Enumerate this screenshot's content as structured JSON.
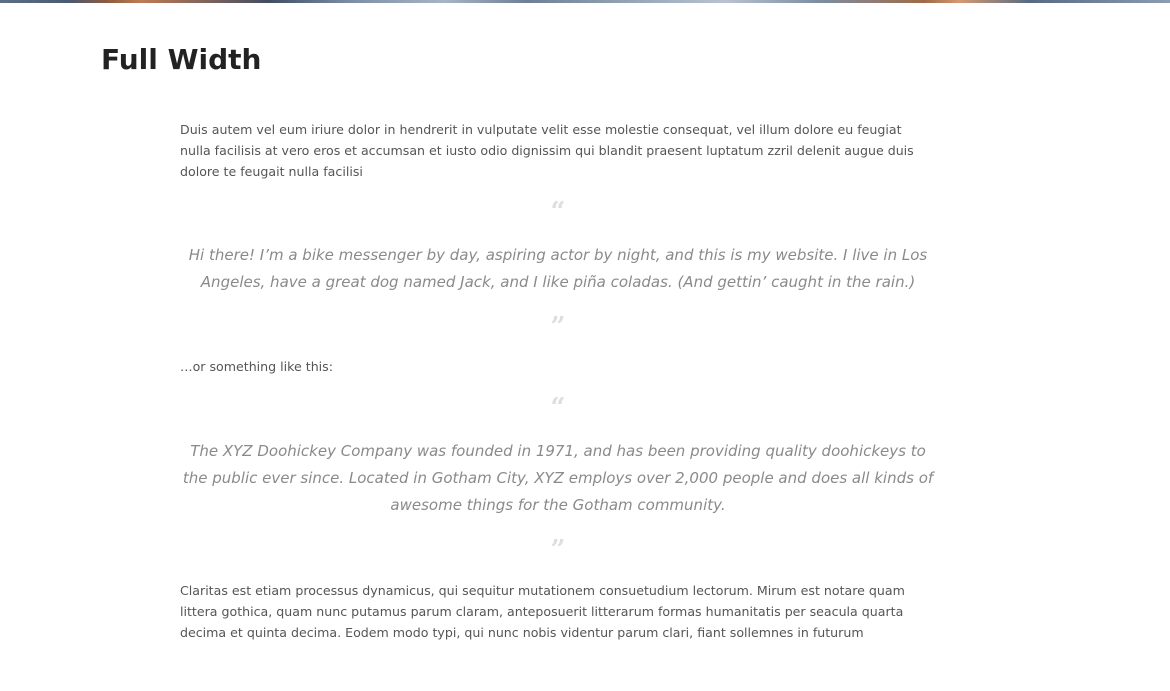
{
  "page": {
    "title": "Full Width"
  },
  "content": {
    "intro": "Duis autem vel eum iriure dolor in hendrerit in vulputate velit esse molestie consequat, vel illum dolore eu feugiat nulla facilisis at vero eros et accumsan et iusto odio dignissim qui blandit praesent luptatum zzril delenit augue duis dolore te feugait nulla facilisi",
    "quote_1": "Hi there! I’m a bike messenger by day, aspiring actor by night, and this is my website. I live in Los Angeles, have a great dog named Jack, and I like piña coladas. (And gettin’ caught in the rain.)",
    "between": "…or something like this:",
    "quote_2": "The XYZ Doohickey Company was founded in 1971, and has been providing quality doohickeys to the public ever since. Located in Gotham City, XYZ employs over 2,000 people and does all kinds of awesome things for the Gotham community.",
    "outro": "Claritas est etiam processus dynamicus, qui sequitur mutationem consuetudium lectorum. Mirum est notare quam littera gothica, quam nunc putamus parum claram, anteposuerit litterarum formas humanitatis per seacula quarta decima et quinta decima. Eodem modo typi, qui nunc nobis videntur parum clari, fiant sollemnes in futurum"
  },
  "icons": {
    "quote_open": "quote-open-icon",
    "quote_close": "quote-close-icon"
  },
  "colors": {
    "title": "#222222",
    "body_text": "#555555",
    "quote_text": "#8a8a8a",
    "quote_mark": "#dedede"
  }
}
